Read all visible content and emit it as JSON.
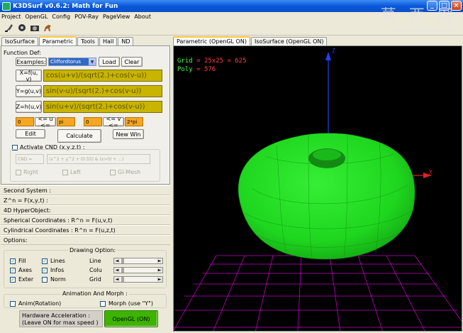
{
  "window": {
    "title": "K3DSurf v0.6.2: Math for Fun"
  },
  "window_buttons": {
    "minimize": "_",
    "maximize": "□",
    "close": "×"
  },
  "menu": [
    "Project",
    "OpenGL",
    "Config",
    "POV-Ray",
    "PageView",
    "About"
  ],
  "left_tabs": [
    "IsoSurface",
    "Parametric",
    "Tools",
    "Hall",
    "ND"
  ],
  "right_tabs": [
    "Parametric (OpenGL ON)",
    "IsoSurface (OpenGL ON)"
  ],
  "function_def": {
    "title": "Function Def:",
    "examples_label": "Examples:",
    "examples_value": "Cliffordtorus",
    "load": "Load",
    "clear": "Clear",
    "x_label": "X=f(u, v)",
    "x_value": "cos(u+v)/(sqrt(2.)+cos(v-u))",
    "y_label": "Y=g(u,v)",
    "y_value": "sin(v-u)/(sqrt(2.)+cos(v-u))",
    "z_label": "Z=h(u,v)",
    "z_value": "sin(u+v)/(sqrt(2.)+cos(v-u))",
    "u_min": "0",
    "u_range_label": "<= u <=",
    "u_max": "pi",
    "v_min": "0",
    "v_range_label": "<= v <=",
    "v_max": "2*pi",
    "edit": "Edit",
    "calculate": "Calculate",
    "new_win": "New Win"
  },
  "cnd": {
    "activate": "Activate CND (x,y,z,t) :",
    "cnd_label": "CND =",
    "cnd_value": "(x^2 + y^2 + (0.55) & (x>0) + ...)",
    "opt1": "Right",
    "opt2": "Left",
    "opt3": "Gl-Mesh"
  },
  "sections": [
    "Second System :",
    "Z^n = F(x,y,t) :",
    "4D HyperObject:",
    "Spherical Coordinates : R^n = F(u,v,t)",
    "Cylindrical Coordinates : R^n = F(u,z,t)",
    "Options:"
  ],
  "drawing_option": {
    "title": "Drawing Option:",
    "fill": "Fill",
    "lines": "Lines",
    "axes": "Axes",
    "infos": "Infos",
    "exter": "Exter",
    "norm": "Norm",
    "line": "Line",
    "colu": "Colu",
    "grid": "Grid",
    "slider_left": "◄",
    "slider_right": "►"
  },
  "animation": {
    "title": "Animation And Morph :",
    "anim": "Anim(Rotation)",
    "morph": "Morph (use \"Y\")"
  },
  "hardware": {
    "line1": "Hardware Acceleration :",
    "line2": "(Leave ON for max speed )",
    "opengl": "OpenGL (ON)"
  },
  "viewport": {
    "grid_label": "Grid",
    "grid_value": "= 25x25 = 625",
    "poly_label": "Poly",
    "poly_value": "= 576",
    "axis_x": "X",
    "axis_z": "Z"
  },
  "watermark": {
    "line1": "莫 西 网",
    "line2": "www.3dmox.com"
  },
  "colors": {
    "surface": "#1fd61f",
    "grid": "#c000c0",
    "z_axis": "#2040ff",
    "x_axis": "#e02020",
    "grid_text": "#40ff40",
    "poly_text": "#ff4040",
    "func_box": "#c9b400",
    "range_box": "#f5a623",
    "opengl_button": "#3cb400"
  }
}
